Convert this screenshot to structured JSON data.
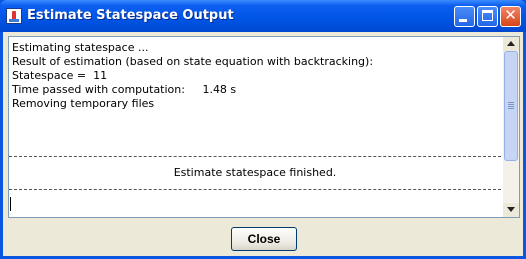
{
  "window": {
    "title": "Estimate Statespace Output"
  },
  "titlebar": {
    "icon": "java-app-icon",
    "minimize": "minimize-icon",
    "maximize": "maximize-icon",
    "close_glyph": "✕"
  },
  "output": {
    "lines": [
      "Estimating statespace ...",
      "Result of estimation (based on state equation with backtracking):",
      "Statespace =  11",
      "Time passed with computation:     1.48 s",
      "Removing temporary files"
    ],
    "status": "Estimate statespace finished."
  },
  "footer": {
    "close_label": "Close"
  }
}
